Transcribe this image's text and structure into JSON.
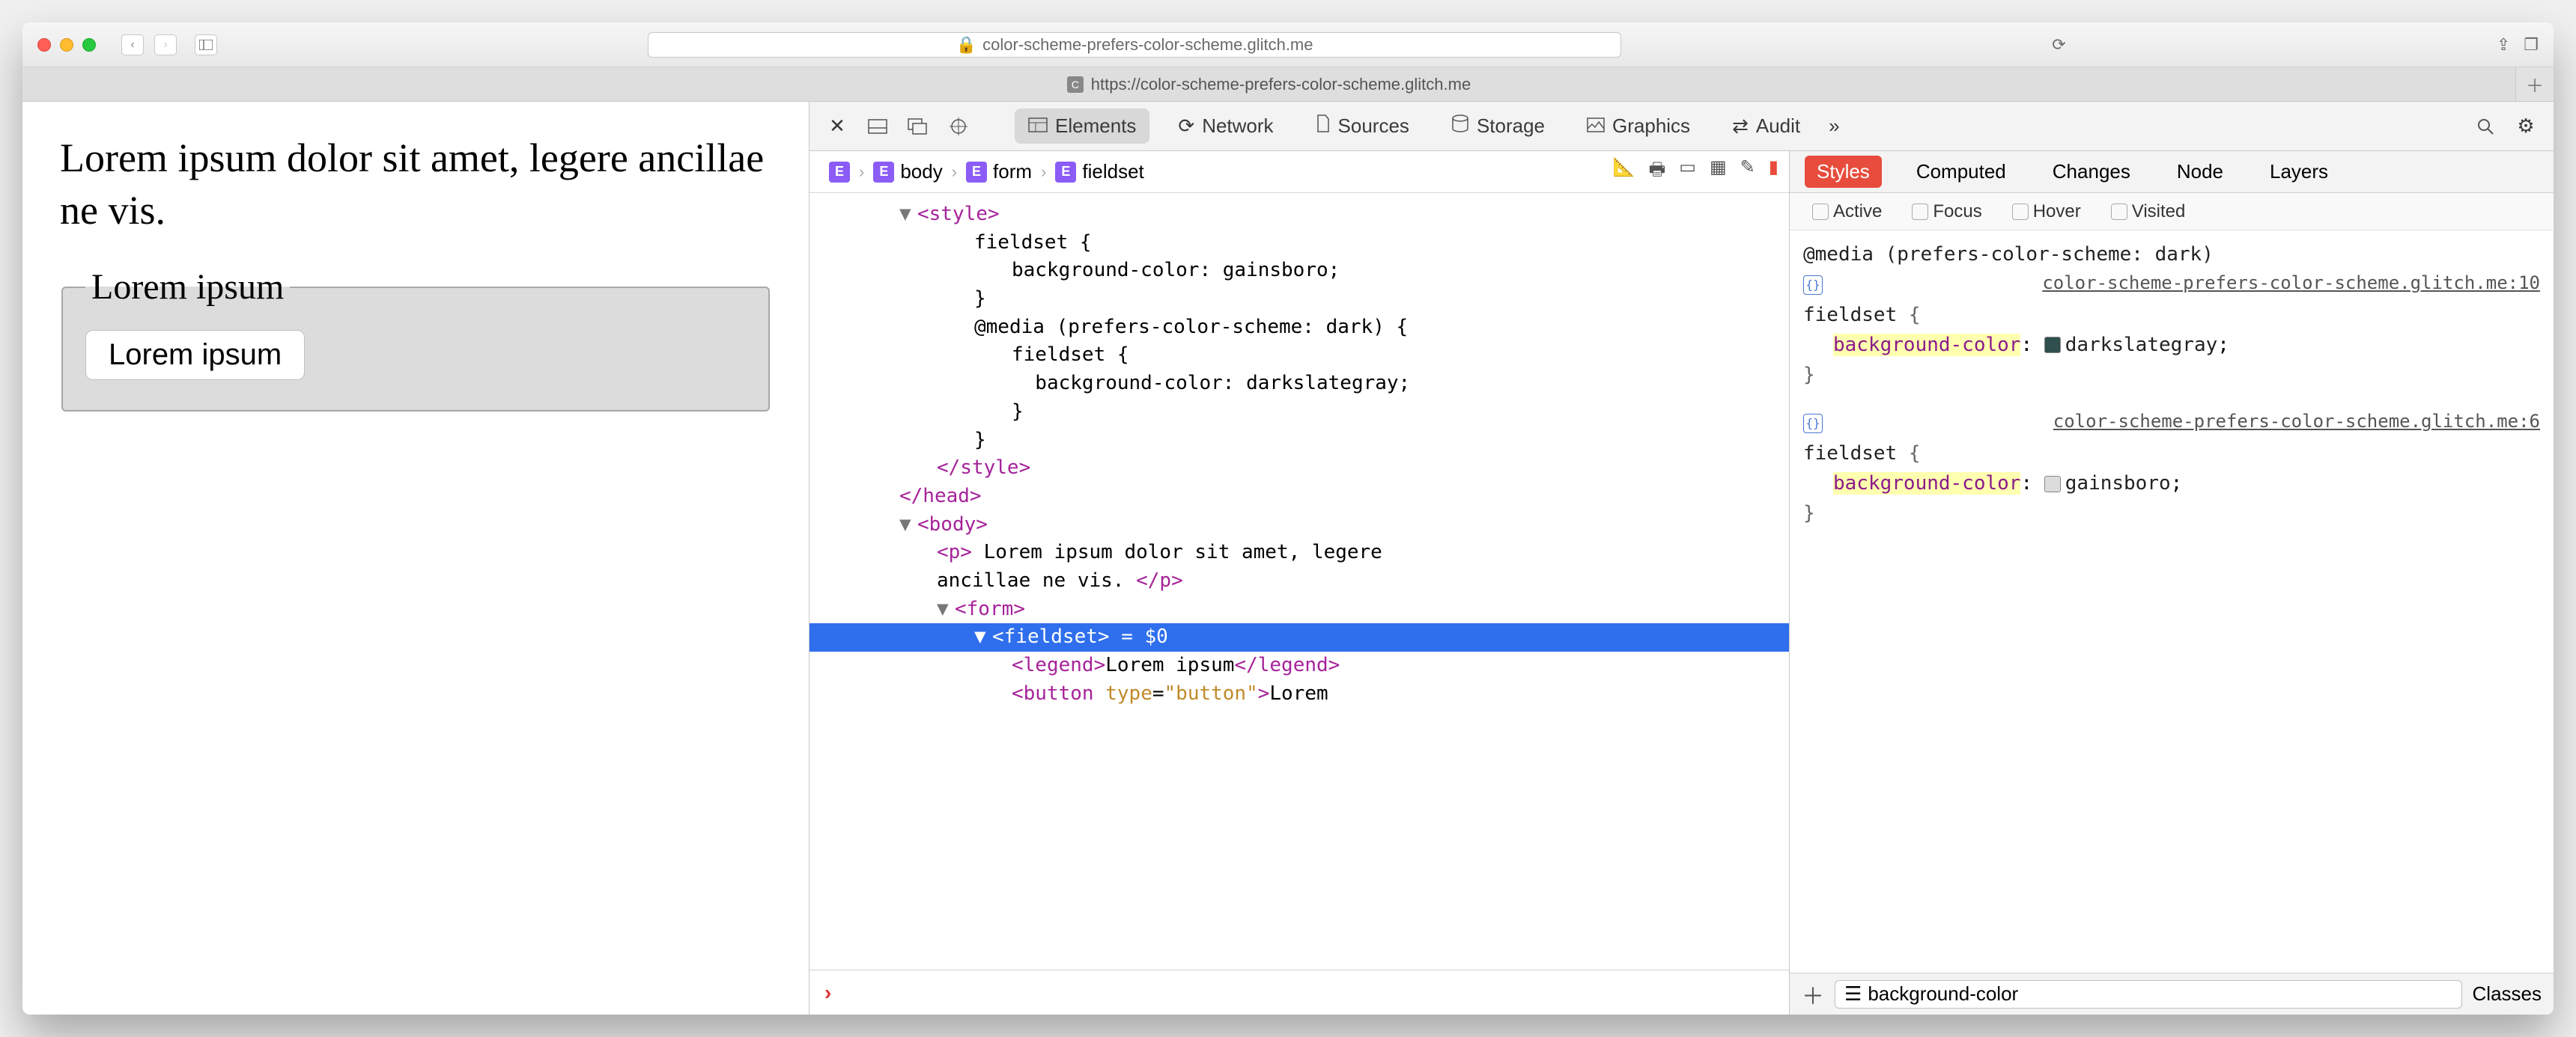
{
  "window": {
    "url_display": "color-scheme-prefers-color-scheme.glitch.me",
    "tab_label": "https://color-scheme-prefers-color-scheme.glitch.me",
    "tab_favicon_letter": "C"
  },
  "preview": {
    "paragraph": "Lorem ipsum dolor sit amet, legere ancillae ne vis.",
    "legend": "Lorem ipsum",
    "button": "Lorem ipsum"
  },
  "devtools": {
    "tabs": {
      "elements": "Elements",
      "network": "Network",
      "sources": "Sources",
      "storage": "Storage",
      "graphics": "Graphics",
      "audit": "Audit"
    },
    "breadcrumbs": [
      "body",
      "form",
      "fieldset"
    ],
    "dom_lines": [
      {
        "cls": "indent1",
        "html": "<span class='tri'>▼</span><span class='tag'>&lt;style&gt;</span>"
      },
      {
        "cls": "indent3",
        "html": "fieldset {"
      },
      {
        "cls": "indent4",
        "html": "background-color: gainsboro;"
      },
      {
        "cls": "indent3",
        "html": "}"
      },
      {
        "cls": "indent3",
        "html": "@media (prefers-color-scheme: dark) {"
      },
      {
        "cls": "indent4",
        "html": "fieldset {"
      },
      {
        "cls": "indent4",
        "html": "  background-color: darkslategray;"
      },
      {
        "cls": "indent4",
        "html": "}"
      },
      {
        "cls": "indent3",
        "html": "}"
      },
      {
        "cls": "indent2",
        "html": "<span class='tag'>&lt;/style&gt;</span>"
      },
      {
        "cls": "indent1",
        "html": "<span class='tag'>&lt;/head&gt;</span>"
      },
      {
        "cls": "indent1",
        "html": "<span class='tri'>▼</span><span class='tag'>&lt;body&gt;</span>"
      },
      {
        "cls": "indent2",
        "html": "<span class='tag'>&lt;p&gt;</span> Lorem ipsum dolor sit amet, legere"
      },
      {
        "cls": "indent2",
        "html": "ancillae ne vis. <span class='tag'>&lt;/p&gt;</span>"
      },
      {
        "cls": "indent2",
        "html": "<span class='tri'>▼</span><span class='tag'>&lt;form&gt;</span>"
      },
      {
        "cls": "indent3 selected",
        "html": "<span class='tri' style='color:#fff'>▼</span><span class='tag'>&lt;fieldset&gt;</span> <span class='txt'>= $0</span>"
      },
      {
        "cls": "indent4",
        "html": "<span class='tag'>&lt;legend&gt;</span>Lorem ipsum<span class='tag'>&lt;/legend&gt;</span>"
      },
      {
        "cls": "indent4",
        "html": "<span class='tag'>&lt;button</span> <span class='attr'>type</span>=<span class='attr'>\"button\"</span><span class='tag'>&gt;</span>Lorem"
      }
    ]
  },
  "styles": {
    "tabs": {
      "styles": "Styles",
      "computed": "Computed",
      "changes": "Changes",
      "node": "Node",
      "layers": "Layers"
    },
    "pseudo": {
      "active": "Active",
      "focus": "Focus",
      "hover": "Hover",
      "visited": "Visited"
    },
    "rule1": {
      "media": "@media (prefers-color-scheme: dark)",
      "link": "color-scheme-prefers-color-scheme.glitch.me:10",
      "selector": "fieldset",
      "prop": "background-color",
      "value": "darkslategray"
    },
    "rule2": {
      "link": "color-scheme-prefers-color-scheme.glitch.me:6",
      "selector": "fieldset",
      "prop": "background-color",
      "value": "gainsboro"
    },
    "footer": {
      "filter": "background-color",
      "classes": "Classes"
    }
  }
}
